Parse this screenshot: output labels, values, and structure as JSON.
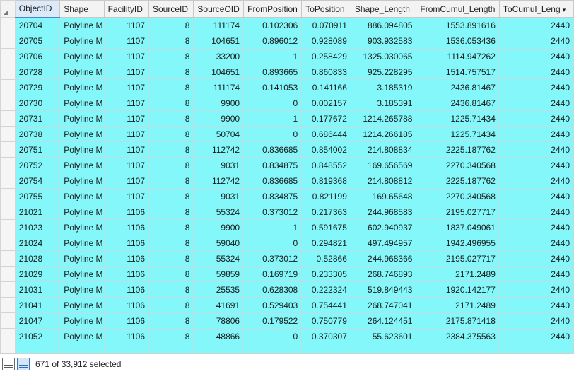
{
  "columns": [
    {
      "key": "ObjectID",
      "label": "ObjectID",
      "width": 61,
      "align": "txt",
      "active": true
    },
    {
      "key": "Shape",
      "label": "Shape",
      "width": 60,
      "align": "txt"
    },
    {
      "key": "FacilityID",
      "label": "FacilityID",
      "width": 61,
      "align": "num"
    },
    {
      "key": "SourceID",
      "label": "SourceID",
      "width": 61,
      "align": "num"
    },
    {
      "key": "SourceOID",
      "label": "SourceOID",
      "width": 68,
      "align": "num"
    },
    {
      "key": "FromPosition",
      "label": "FromPosition",
      "width": 79,
      "align": "num"
    },
    {
      "key": "ToPosition",
      "label": "ToPosition",
      "width": 67,
      "align": "num"
    },
    {
      "key": "Shape_Length",
      "label": "Shape_Length",
      "width": 89,
      "align": "num"
    },
    {
      "key": "FromCumul_Length",
      "label": "FromCumul_Length",
      "width": 113,
      "align": "num"
    },
    {
      "key": "ToCumul_Length",
      "label": "ToCumul_Leng",
      "width": 101,
      "align": "num",
      "sort_indicator": "▾"
    }
  ],
  "rows": [
    [
      "20704",
      "Polyline M",
      "1107",
      "8",
      "111174",
      "0.102306",
      "0.070911",
      "886.094805",
      "1553.891616",
      "2440"
    ],
    [
      "20705",
      "Polyline M",
      "1107",
      "8",
      "104651",
      "0.896012",
      "0.928089",
      "903.932583",
      "1536.053436",
      "2440"
    ],
    [
      "20706",
      "Polyline M",
      "1107",
      "8",
      "33200",
      "1",
      "0.258429",
      "1325.030065",
      "1114.947262",
      "2440"
    ],
    [
      "20728",
      "Polyline M",
      "1107",
      "8",
      "104651",
      "0.893665",
      "0.860833",
      "925.228295",
      "1514.757517",
      "2440"
    ],
    [
      "20729",
      "Polyline M",
      "1107",
      "8",
      "111174",
      "0.141053",
      "0.141166",
      "3.185319",
      "2436.81467",
      "2440"
    ],
    [
      "20730",
      "Polyline M",
      "1107",
      "8",
      "9900",
      "0",
      "0.002157",
      "3.185391",
      "2436.81467",
      "2440"
    ],
    [
      "20731",
      "Polyline M",
      "1107",
      "8",
      "9900",
      "1",
      "0.177672",
      "1214.265788",
      "1225.71434",
      "2440"
    ],
    [
      "20738",
      "Polyline M",
      "1107",
      "8",
      "50704",
      "0",
      "0.686444",
      "1214.266185",
      "1225.71434",
      "2440"
    ],
    [
      "20751",
      "Polyline M",
      "1107",
      "8",
      "112742",
      "0.836685",
      "0.854002",
      "214.808834",
      "2225.187762",
      "2440"
    ],
    [
      "20752",
      "Polyline M",
      "1107",
      "8",
      "9031",
      "0.834875",
      "0.848552",
      "169.656569",
      "2270.340568",
      "2440"
    ],
    [
      "20754",
      "Polyline M",
      "1107",
      "8",
      "112742",
      "0.836685",
      "0.819368",
      "214.808812",
      "2225.187762",
      "2440"
    ],
    [
      "20755",
      "Polyline M",
      "1107",
      "8",
      "9031",
      "0.834875",
      "0.821199",
      "169.65648",
      "2270.340568",
      "2440"
    ],
    [
      "21021",
      "Polyline M",
      "1106",
      "8",
      "55324",
      "0.373012",
      "0.217363",
      "244.968583",
      "2195.027717",
      "2440"
    ],
    [
      "21023",
      "Polyline M",
      "1106",
      "8",
      "9900",
      "1",
      "0.591675",
      "602.940937",
      "1837.049061",
      "2440"
    ],
    [
      "21024",
      "Polyline M",
      "1106",
      "8",
      "59040",
      "0",
      "0.294821",
      "497.494957",
      "1942.496955",
      "2440"
    ],
    [
      "21028",
      "Polyline M",
      "1106",
      "8",
      "55324",
      "0.373012",
      "0.52866",
      "244.968366",
      "2195.027717",
      "2440"
    ],
    [
      "21029",
      "Polyline M",
      "1106",
      "8",
      "59859",
      "0.169719",
      "0.233305",
      "268.746893",
      "2171.2489",
      "2440"
    ],
    [
      "21031",
      "Polyline M",
      "1106",
      "8",
      "25535",
      "0.628308",
      "0.222324",
      "519.849443",
      "1920.142177",
      "2440"
    ],
    [
      "21041",
      "Polyline M",
      "1106",
      "8",
      "41691",
      "0.529403",
      "0.754441",
      "268.747041",
      "2171.2489",
      "2440"
    ],
    [
      "21047",
      "Polyline M",
      "1106",
      "8",
      "78806",
      "0.179522",
      "0.750779",
      "264.124451",
      "2175.871418",
      "2440"
    ],
    [
      "21052",
      "Polyline M",
      "1106",
      "8",
      "48866",
      "0",
      "0.370307",
      "55.623601",
      "2384.375563",
      "2440"
    ],
    [
      "",
      "",
      "",
      "",
      "",
      "",
      "",
      "",
      "",
      ""
    ]
  ],
  "status": {
    "selection_text": "671 of 33,912 selected",
    "view_all_icon": "table-all-records-icon",
    "view_selected_icon": "table-selected-records-icon"
  },
  "colors": {
    "selected_row": "#84f7fb",
    "header": "#f3f3f3",
    "active_header": "#dce9f8"
  }
}
